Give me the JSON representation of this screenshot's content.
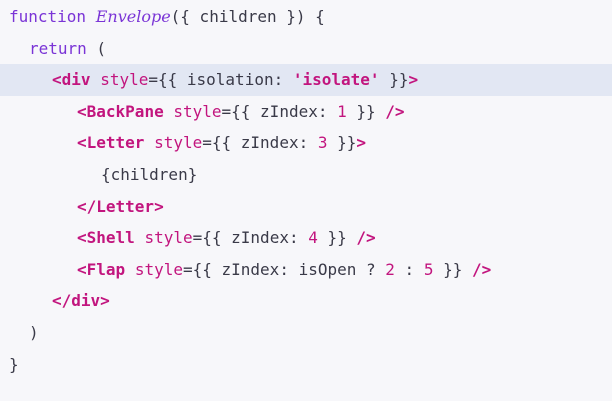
{
  "code": {
    "l1": {
      "kw": "function",
      "name": "Envelope",
      "rest": "({ children }) {"
    },
    "l2": {
      "kw": "return",
      "rest": " ("
    },
    "l3": {
      "open": "<",
      "tag": "div",
      "attr": "style",
      "pre": "={{ isolation: ",
      "str": "'isolate'",
      "post": " }}",
      "close": ">"
    },
    "l4": {
      "open": "<",
      "tag": "BackPane",
      "attr": "style",
      "pre": "={{ zIndex: ",
      "num": "1",
      "post": " }} ",
      "close": "/>"
    },
    "l5": {
      "open": "<",
      "tag": "Letter",
      "attr": "style",
      "pre": "={{ zIndex: ",
      "num": "3",
      "post": " }}",
      "close": ">"
    },
    "l6": {
      "text": "{children}"
    },
    "l7": {
      "tag": "</Letter>"
    },
    "l8": {
      "open": "<",
      "tag": "Shell",
      "attr": "style",
      "pre": "={{ zIndex: ",
      "num": "4",
      "post": " }} ",
      "close": "/>"
    },
    "l9": {
      "open": "<",
      "tag": "Flap",
      "attr": "style",
      "pre": "={{ zIndex: isOpen ? ",
      "num1": "2",
      "mid": " : ",
      "num2": "5",
      "post": " }} ",
      "close": "/>"
    },
    "l10": {
      "tag": "</div>"
    },
    "l11": {
      "text": ")"
    },
    "l12": {
      "text": "}"
    }
  },
  "colors": {
    "background": "#f7f7fa",
    "highlight": "#e2e7f3",
    "keyword": "#7a34d6",
    "tag": "#c2157e",
    "text": "#3a3a48"
  }
}
